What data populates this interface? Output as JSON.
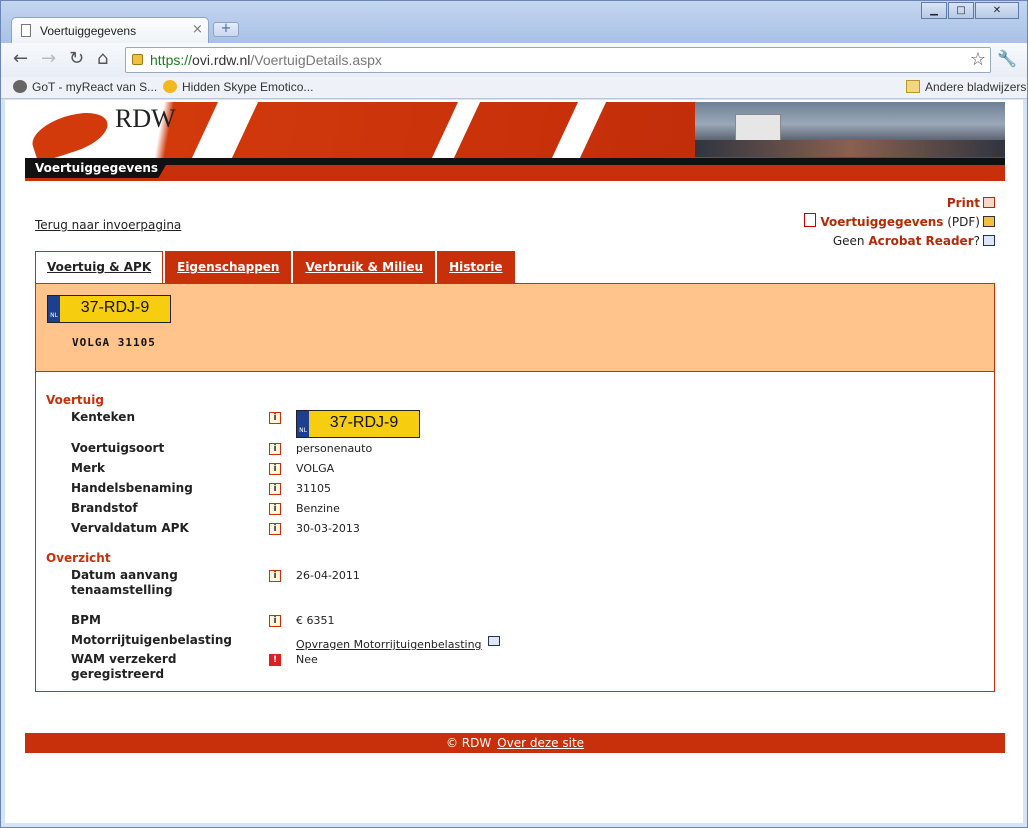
{
  "browser": {
    "tab_title": "Voertuiggegevens",
    "tab_close": "×",
    "new_tab": "+",
    "url_scheme": "https://",
    "url_host": "ovi.rdw.nl",
    "url_path": "/VoertuigDetails.aspx",
    "window_minimize": "▁",
    "window_maximize": "□",
    "window_close": "✕",
    "bookmarks": [
      "GoT - myReact van S...",
      "Hidden Skype Emotico..."
    ],
    "other_bookmarks": "Andere bladwijzers"
  },
  "site": {
    "logo_text": "RDW",
    "section_label": "Voertuiggegevens"
  },
  "links": {
    "back": "Terug naar invoerpagina",
    "print": "Print",
    "pdf_label": "Voertuiggegevens",
    "pdf_suffix": "(PDF)",
    "reader_prefix": "Geen",
    "reader_link": "Acrobat Reader",
    "reader_suffix": "?"
  },
  "tabs": [
    {
      "label": "Voertuig & APK",
      "active": true
    },
    {
      "label": "Eigenschappen",
      "active": false
    },
    {
      "label": "Verbruik & Milieu",
      "active": false
    },
    {
      "label": "Historie",
      "active": false
    }
  ],
  "header": {
    "plate": "37-RDJ-9",
    "plate_country": "NL",
    "model": "VOLGA 31105"
  },
  "sections": {
    "voertuig": "Voertuig",
    "overzicht": "Overzicht"
  },
  "voertuig_rows": [
    {
      "label": "Kenteken",
      "value": "37-RDJ-9"
    },
    {
      "label": "Voertuigsoort",
      "value": "personenauto"
    },
    {
      "label": "Merk",
      "value": "VOLGA"
    },
    {
      "label": "Handelsbenaming",
      "value": "31105"
    },
    {
      "label": "Brandstof",
      "value": "Benzine"
    },
    {
      "label": "Vervaldatum APK",
      "value": "30-03-2013"
    }
  ],
  "overzicht_rows": [
    {
      "label": "Datum aanvang tenaamstelling",
      "value": "26-04-2011"
    },
    {
      "label": "BPM",
      "value": "€ 6351"
    },
    {
      "label": "Motorrijtuigenbelasting",
      "value": "Opvragen Motorrijtuigenbelasting"
    },
    {
      "label": "WAM verzekerd geregistreerd",
      "value": "Nee"
    }
  ],
  "footer": {
    "copyright": "© RDW",
    "about": "Over deze site"
  },
  "icons": {
    "info": "i",
    "warning": "!"
  },
  "colors": {
    "brand_red": "#c7300a",
    "header_bg": "#fec48c",
    "plate_yellow": "#f7cd10"
  }
}
